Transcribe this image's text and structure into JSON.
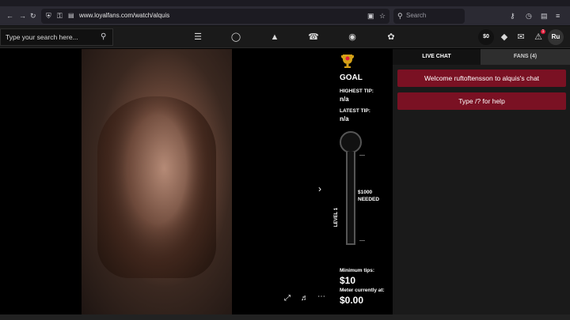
{
  "browser": {
    "url": "www.loyalfans.com/watch/alquis",
    "search_placeholder": "Search"
  },
  "site_nav": {
    "search_placeholder": "Type your search here...",
    "balance": "$0",
    "notification_count": "1",
    "avatar_initials": "Ru"
  },
  "goal": {
    "title": "GOAL",
    "highest_tip_label": "HIGHEST TIP:",
    "highest_tip_value": "n/a",
    "latest_tip_label": "LATEST TIP:",
    "latest_tip_value": "n/a",
    "needed_amount": "$1000",
    "needed_label": "NEEDED",
    "level_label": "LEVEL 1",
    "min_tips_label": "Minimum tips:",
    "min_tips_value": "$10",
    "meter_label": "Meter currently at:",
    "meter_value": "$0.00",
    "progress_fraction": 0
  },
  "chat": {
    "tabs": [
      {
        "label": "LIVE CHAT",
        "active": true
      },
      {
        "label": "FANS (4)",
        "active": false
      }
    ],
    "messages": [
      "Welcome ruftoftensson to alquis's chat",
      "Type /? for help"
    ]
  },
  "colors": {
    "accent_red": "#7a1123",
    "badge_red": "#e01e3c",
    "trophy_gold": "#d4a017"
  }
}
